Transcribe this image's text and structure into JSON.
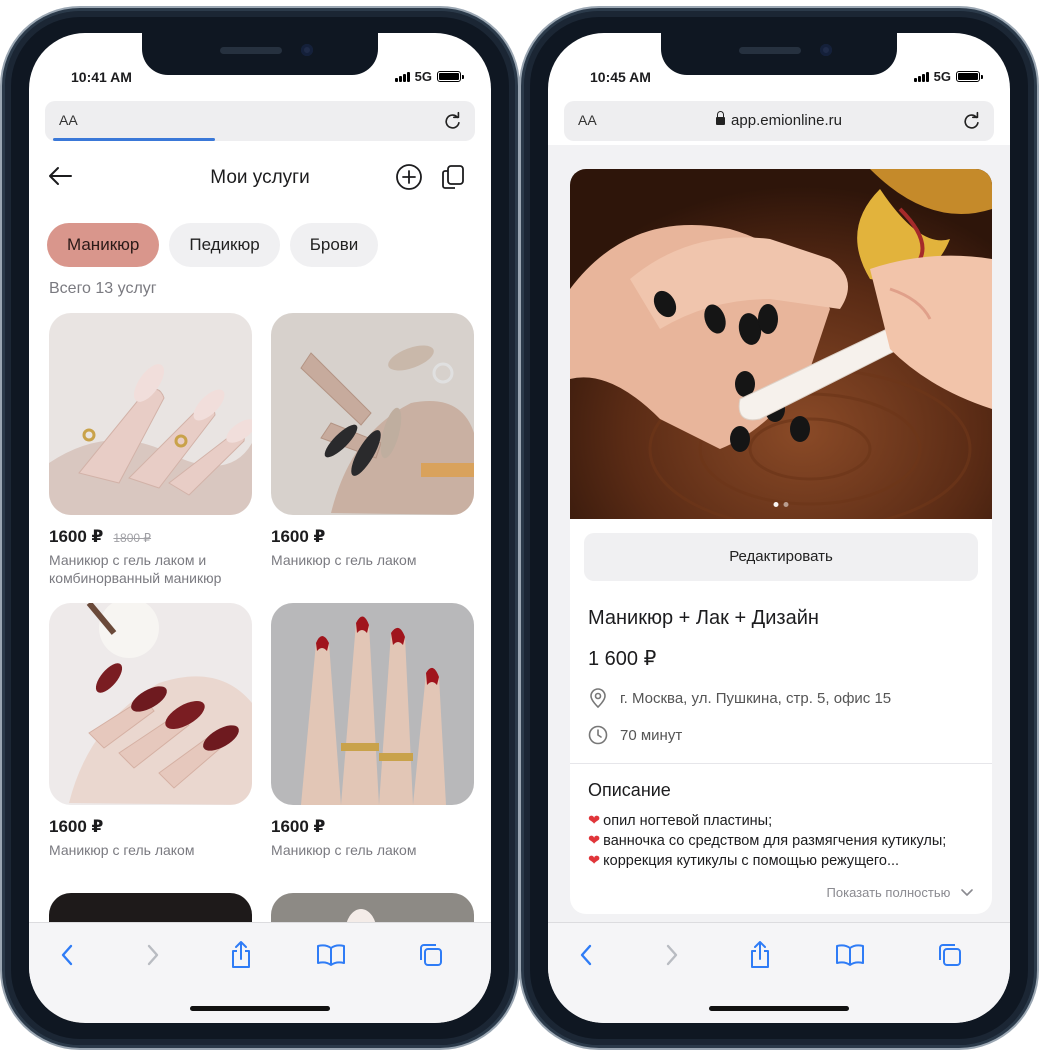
{
  "left": {
    "status_time": "10:41 AM",
    "network": "5G",
    "urlbar_aa": "AA",
    "header_title": "Мои услуги",
    "chips": [
      "Маникюр",
      "Педикюр",
      "Брови"
    ],
    "total": "Всего 13 услуг",
    "cards": [
      {
        "price": "1600 ₽",
        "old_price": "1800 ₽",
        "name": "Маникюр с гель лаком и комбинорванный маникюр"
      },
      {
        "price": "1600 ₽",
        "name": "Маникюр с гель лаком"
      },
      {
        "price": "1600 ₽",
        "name": "Маникюр с гель лаком"
      },
      {
        "price": "1600 ₽",
        "name": "Маникюр с гель лаком"
      }
    ]
  },
  "right": {
    "status_time": "10:45 AM",
    "network": "5G",
    "urlbar_aa": "AA",
    "url": "app.emionline.ru",
    "edit_label": "Редактировать",
    "service_title": "Маникюр + Лак + Дизайн",
    "price": "1 600 ₽",
    "address": "г. Москва, ул. Пушкина, стр. 5, офис 15",
    "duration": "70 минут",
    "description_title": "Описание",
    "description_items": [
      "опил ногтевой пластины;",
      "ванночка со средством для размягчения кутикулы;",
      "коррекция кутикулы с помощью режущего..."
    ],
    "show_more": "Показать полностью"
  }
}
